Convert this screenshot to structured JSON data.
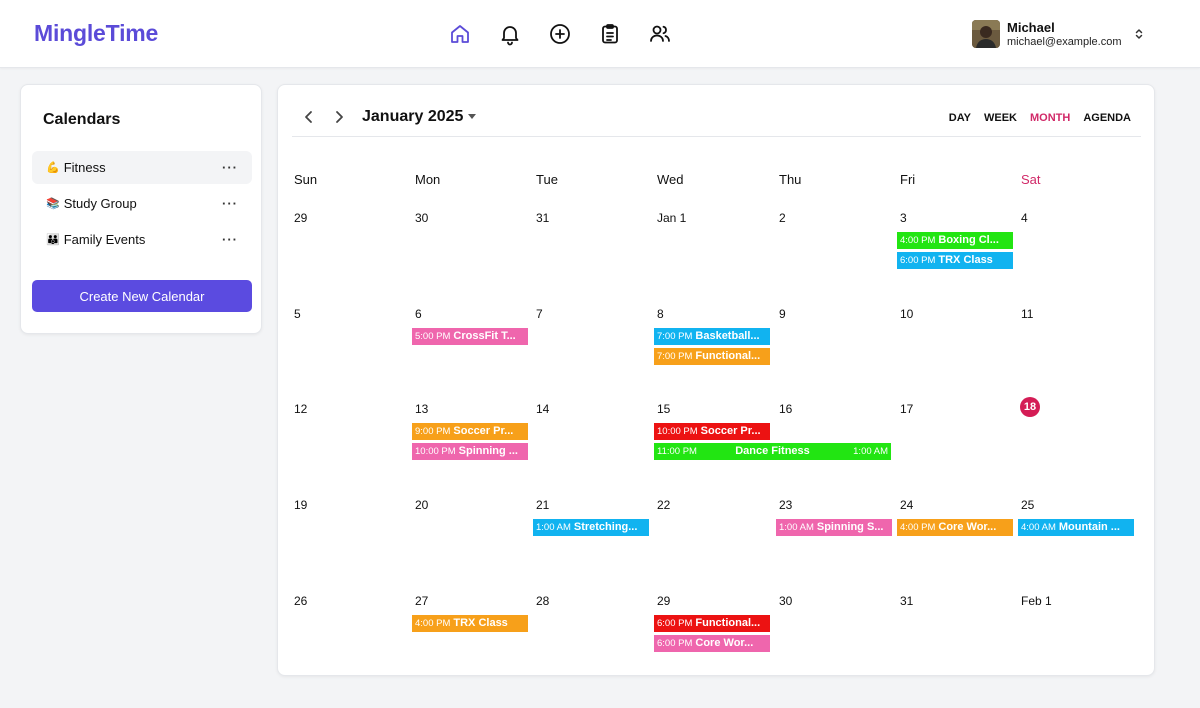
{
  "app": {
    "name": "MingleTime"
  },
  "user": {
    "name": "Michael",
    "email": "michael@example.com"
  },
  "nav": [
    "home-icon",
    "bell-icon",
    "plus-circle-icon",
    "clipboard-icon",
    "users-icon"
  ],
  "colors": {
    "brand": "#5b4bd8",
    "accent": "#d12968",
    "green": "#22e512",
    "cyan": "#11b3f0",
    "orange": "#f7a01a",
    "pink": "#ef66ad",
    "red": "#ec1212"
  },
  "sidebar": {
    "title": "Calendars",
    "calendars": [
      {
        "emoji": "💪",
        "name": "Fitness",
        "more": "···",
        "active": true
      },
      {
        "emoji": "📚",
        "name": "Study Group",
        "more": "···"
      },
      {
        "emoji": "👪",
        "name": "Family Events",
        "more": "···"
      }
    ],
    "create_label": "Create New Calendar"
  },
  "calendar": {
    "title": "January 2025",
    "views": [
      "DAY",
      "WEEK",
      "MONTH",
      "AGENDA"
    ],
    "active_view": "MONTH",
    "weekdays": [
      "Sun",
      "Mon",
      "Tue",
      "Wed",
      "Thu",
      "Fri",
      "Sat"
    ],
    "weeks": [
      [
        "29",
        "30",
        "31",
        "Jan 1",
        "2",
        "3",
        "4"
      ],
      [
        "5",
        "6",
        "7",
        "8",
        "9",
        "10",
        "11"
      ],
      [
        "12",
        "13",
        "14",
        "15",
        "16",
        "17",
        "18"
      ],
      [
        "19",
        "20",
        "21",
        "22",
        "23",
        "24",
        "25"
      ],
      [
        "26",
        "27",
        "28",
        "29",
        "30",
        "31",
        "Feb 1"
      ]
    ],
    "today": "18",
    "events": [
      {
        "week": 0,
        "day": 5,
        "slot": 0,
        "time": "4:00 PM",
        "title": "Boxing Cl...",
        "color": "green"
      },
      {
        "week": 0,
        "day": 5,
        "slot": 1,
        "time": "6:00 PM",
        "title": "TRX Class",
        "color": "cyan"
      },
      {
        "week": 1,
        "day": 1,
        "slot": 0,
        "time": "5:00 PM",
        "title": "CrossFit T...",
        "color": "pink"
      },
      {
        "week": 1,
        "day": 3,
        "slot": 0,
        "time": "7:00 PM",
        "title": "Basketball...",
        "color": "cyan"
      },
      {
        "week": 1,
        "day": 3,
        "slot": 1,
        "time": "7:00 PM",
        "title": "Functional...",
        "color": "orange"
      },
      {
        "week": 2,
        "day": 1,
        "slot": 0,
        "time": "9:00 PM",
        "title": "Soccer Pr...",
        "color": "orange"
      },
      {
        "week": 2,
        "day": 1,
        "slot": 1,
        "time": "10:00 PM",
        "title": "Spinning ...",
        "color": "pink"
      },
      {
        "week": 2,
        "day": 3,
        "slot": 0,
        "time": "10:00 PM",
        "title": "Soccer Pr...",
        "color": "red"
      },
      {
        "week": 2,
        "day": 3,
        "slot": 1,
        "span": 2,
        "time": "11:00 PM",
        "title": "Dance Fitness",
        "end_time": "1:00 AM",
        "color": "green"
      },
      {
        "week": 3,
        "day": 2,
        "slot": 0,
        "time": "1:00 AM",
        "title": "Stretching...",
        "color": "cyan"
      },
      {
        "week": 3,
        "day": 4,
        "slot": 0,
        "time": "1:00 AM",
        "title": "Spinning S...",
        "color": "pink"
      },
      {
        "week": 3,
        "day": 5,
        "slot": 0,
        "time": "4:00 PM",
        "title": "Core Wor...",
        "color": "orange"
      },
      {
        "week": 3,
        "day": 6,
        "slot": 0,
        "time": "4:00 AM",
        "title": "Mountain ...",
        "color": "cyan"
      },
      {
        "week": 4,
        "day": 1,
        "slot": 0,
        "time": "4:00 PM",
        "title": "TRX Class",
        "color": "orange"
      },
      {
        "week": 4,
        "day": 3,
        "slot": 0,
        "time": "6:00 PM",
        "title": "Functional...",
        "color": "red"
      },
      {
        "week": 4,
        "day": 3,
        "slot": 1,
        "time": "6:00 PM",
        "title": "Core Wor...",
        "color": "pink"
      }
    ]
  }
}
